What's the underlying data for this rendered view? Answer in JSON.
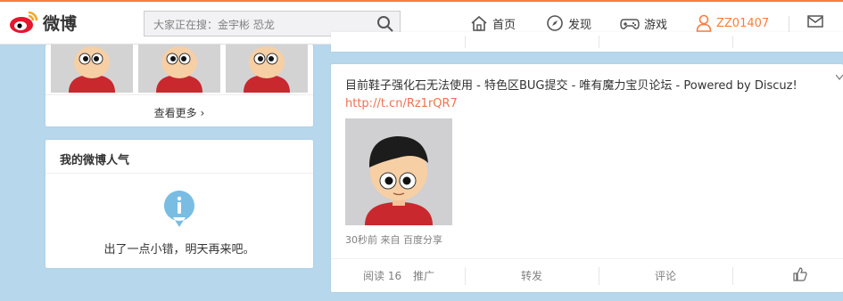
{
  "brand": {
    "name": "微博"
  },
  "search": {
    "placeholder": "大家正在搜：金宇彬 恐龙"
  },
  "nav": {
    "home": "首页",
    "discover": "发现",
    "games": "游戏",
    "user": "ZZ01407"
  },
  "left": {
    "see_more": "查看更多",
    "popularity": {
      "title": "我的微博人气",
      "error": "出了一点小错，明天再来吧。"
    }
  },
  "feed": {
    "title": "目前鞋子强化石无法使用 - 特色区BUG提交 - 唯有魔力宝贝论坛 - Powered by Discuz!",
    "link": "http://t.cn/Rz1rQR7",
    "meta": "30秒前 来自 百度分享",
    "actions": {
      "read_label": "阅读",
      "read_count": "16",
      "promote": "推广",
      "forward": "转发",
      "comment": "评论"
    }
  },
  "colors": {
    "accent": "#fa7d3c",
    "link": "#eb7350",
    "background": "#b7d7ec"
  }
}
